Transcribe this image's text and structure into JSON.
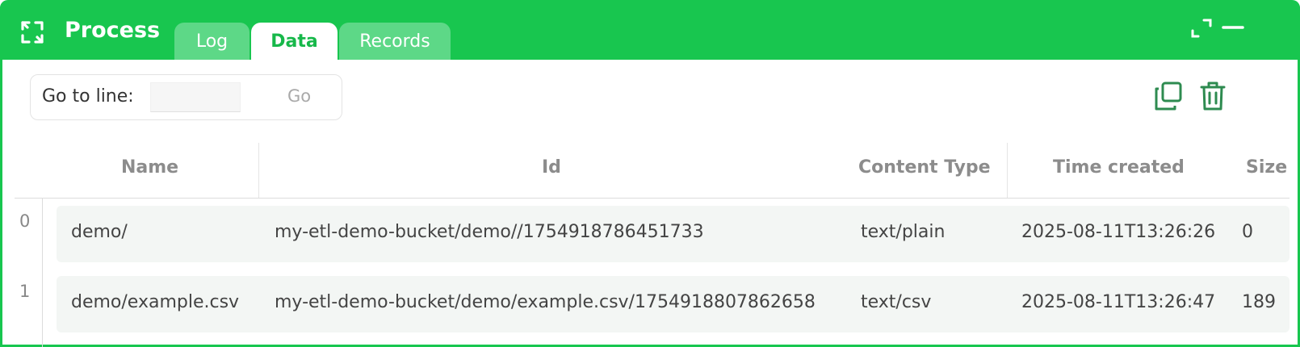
{
  "header": {
    "title": "Process",
    "icon": "process-refresh-icon",
    "tabs": [
      {
        "label": "Log",
        "active": false
      },
      {
        "label": "Data",
        "active": true
      },
      {
        "label": "Records",
        "active": false
      }
    ],
    "accent": "#18c64f"
  },
  "toolbar": {
    "goto_label": "Go to line:",
    "goto_value": "",
    "goto_button": "Go"
  },
  "table": {
    "columns": [
      "Name",
      "Id",
      "Content Type",
      "Time created",
      "Size"
    ],
    "rows": [
      {
        "index": "0",
        "name": "demo/",
        "id": "my-etl-demo-bucket/demo//1754918786451733",
        "content_type": "text/plain",
        "time_created": "2025-08-11T13:26:26",
        "size": "0"
      },
      {
        "index": "1",
        "name": "demo/example.csv",
        "id": "my-etl-demo-bucket/demo/example.csv/1754918807862658",
        "content_type": "text/csv",
        "time_created": "2025-08-11T13:26:47",
        "size": "189"
      }
    ]
  }
}
